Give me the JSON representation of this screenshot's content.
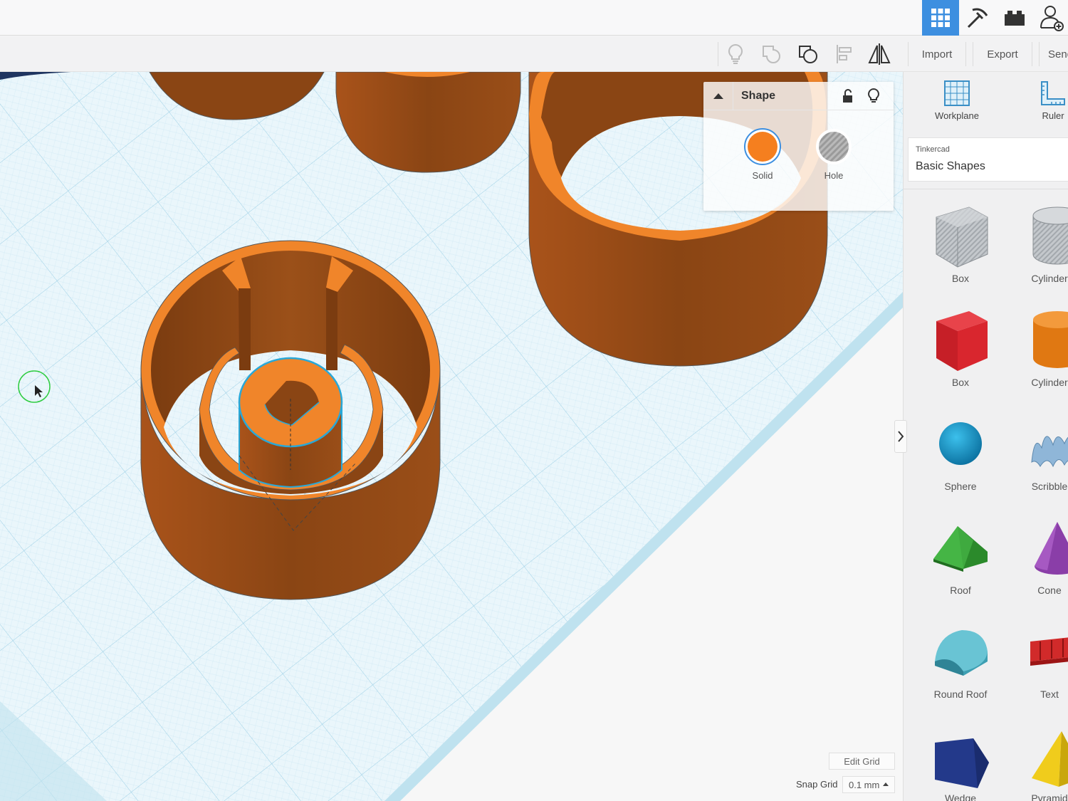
{
  "toolbar": {
    "import_label": "Import",
    "export_label": "Export",
    "send_label": "Send To"
  },
  "shape_panel": {
    "title": "Shape",
    "solid_label": "Solid",
    "hole_label": "Hole",
    "solid_color": "#f57f1f"
  },
  "right_panel": {
    "workplane_label": "Workplane",
    "ruler_label": "Ruler",
    "library_sub": "Tinkercad",
    "library_name": "Basic Shapes",
    "shapes": [
      {
        "label": "Box"
      },
      {
        "label": "Cylinder"
      },
      {
        "label": "Box"
      },
      {
        "label": "Cylinder"
      },
      {
        "label": "Sphere"
      },
      {
        "label": "Scribble"
      },
      {
        "label": "Roof"
      },
      {
        "label": "Cone"
      },
      {
        "label": "Round Roof"
      },
      {
        "label": "Text"
      },
      {
        "label": "Wedge"
      },
      {
        "label": "Pyramid"
      }
    ]
  },
  "grid": {
    "edit_label": "Edit Grid",
    "snap_label": "Snap Grid",
    "snap_value": "0.1 mm"
  },
  "colors": {
    "accent": "#3d8fe0",
    "shape_orange": "#f57f1f",
    "grid_blue": "#a8d6ea"
  }
}
